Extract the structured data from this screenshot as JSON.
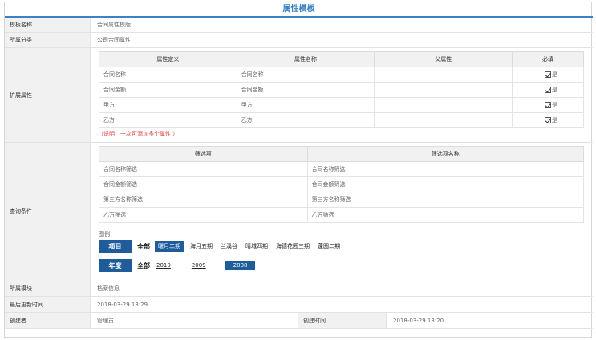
{
  "page": {
    "title": "属性模板"
  },
  "rows": {
    "template_name": {
      "label": "模板名称",
      "value": "合同属性模版"
    },
    "category": {
      "label": "所属分类",
      "value": "公司合同属性"
    },
    "extended": {
      "label": "扩展属性",
      "headers": [
        "属性定义",
        "属性名称",
        "父属性",
        "必填"
      ],
      "items": [
        {
          "def": "合同名称",
          "name": "合同名称",
          "parent": "",
          "required": "是"
        },
        {
          "def": "合同金额",
          "name": "合同金额",
          "parent": "",
          "required": "是"
        },
        {
          "def": "甲方",
          "name": "甲方",
          "parent": "",
          "required": "是"
        },
        {
          "def": "乙方",
          "name": "乙方",
          "parent": "",
          "required": "是"
        }
      ],
      "note": "（说明：一次可添加多个属性 ）"
    },
    "query": {
      "label": "查询条件",
      "headers": [
        "筛选项",
        "筛选项名称"
      ],
      "items": [
        {
          "item": "合同名称筛选",
          "name": "合同名称筛选"
        },
        {
          "item": "合同金额筛选",
          "name": "合同金额筛选"
        },
        {
          "item": "第三方名称筛选",
          "name": "第三方名称筛选"
        },
        {
          "item": "乙方筛选",
          "name": "乙方筛选"
        }
      ],
      "legend_label": "图例：",
      "project_filter": {
        "head": "项目",
        "all": "全部",
        "options": [
          "曙月二期",
          "海月五期",
          "兰溪谷",
          "晴城四期",
          "海德花园三期",
          "蓬园二期"
        ],
        "selected": "曙月二期"
      },
      "year_filter": {
        "head": "年度",
        "all": "全部",
        "options": [
          "2010",
          "2009",
          "2008"
        ],
        "selected": "2008"
      }
    },
    "module": {
      "label": "所属模块",
      "value": "档案信息"
    },
    "updated": {
      "label": "最后更新时间",
      "value": "2018-03-29 13:29"
    },
    "creator": {
      "label": "创建者",
      "value": "管理员",
      "time_label": "创建时间",
      "time_value": "2018-03-29 13:20"
    }
  }
}
